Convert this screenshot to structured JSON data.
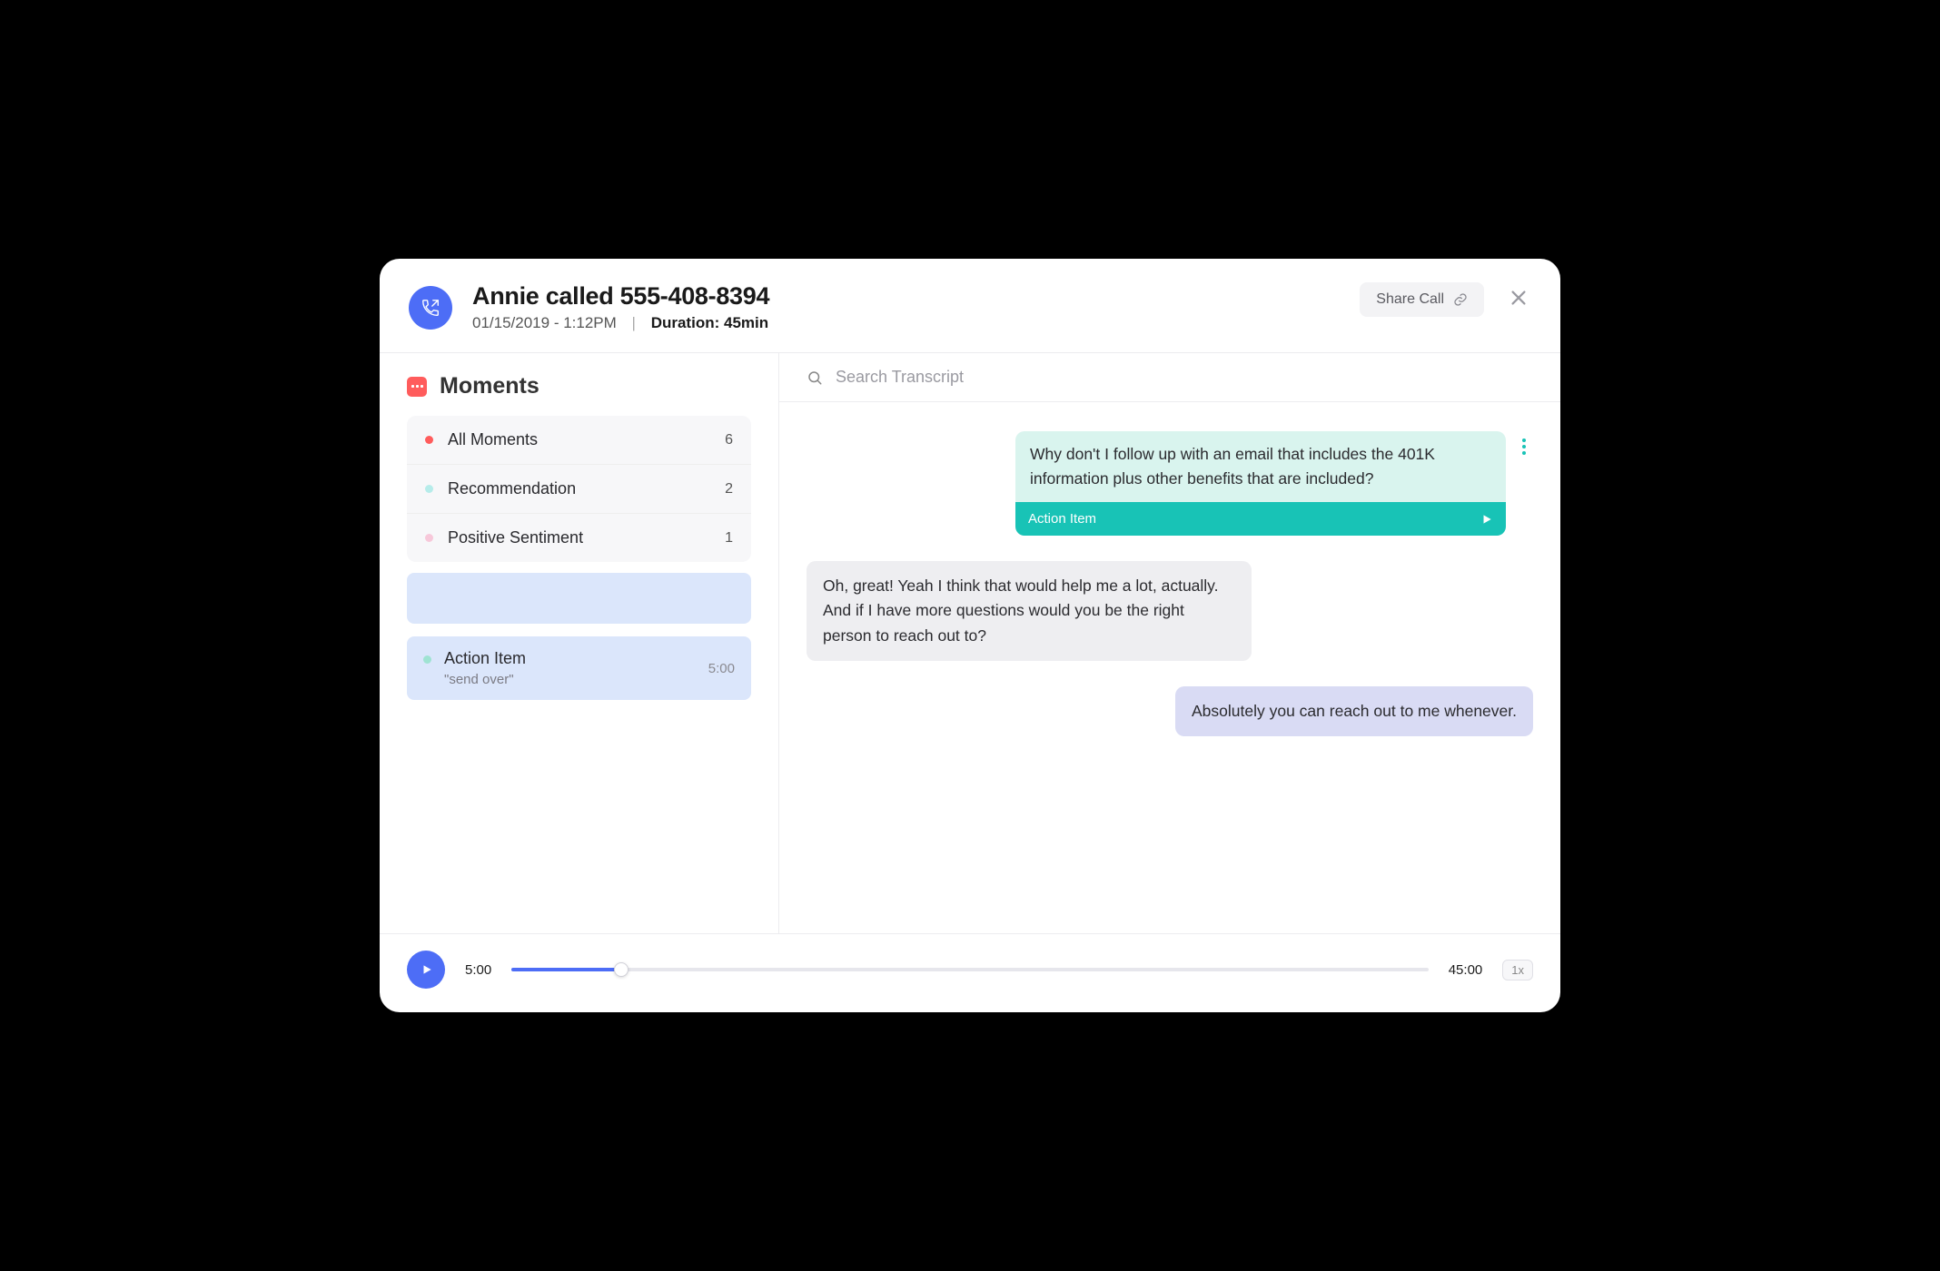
{
  "header": {
    "title": "Annie called 555-408-8394",
    "date": "01/15/2019",
    "time": "1:12PM",
    "duration_label": "Duration:",
    "duration_value": "45min",
    "share_label": "Share Call"
  },
  "sidebar": {
    "title": "Moments",
    "categories": [
      {
        "label": "All Moments",
        "count": "6",
        "dot": "#ff5c5c"
      },
      {
        "label": "Recommendation",
        "count": "2",
        "dot": "#b6ecea"
      },
      {
        "label": "Positive Sentiment",
        "count": "1",
        "dot": "#f7c8da"
      }
    ],
    "detail": {
      "label": "Action Item",
      "snippet": "\"send over\"",
      "time": "5:00"
    }
  },
  "search": {
    "placeholder": "Search Transcript"
  },
  "transcript": {
    "highlight": {
      "text": "Why don't I follow up with an email that includes the 401K information plus other benefits that are included?",
      "tag": "Action Item"
    },
    "msg_grey": "Oh, great! Yeah I think that would help me a lot, actually. And if I have more questions would you be the right person to reach out to?",
    "msg_purple": "Absolutely you can reach out to me whenever."
  },
  "player": {
    "current": "5:00",
    "total": "45:00",
    "speed": "1x",
    "progress_percent": 12
  }
}
